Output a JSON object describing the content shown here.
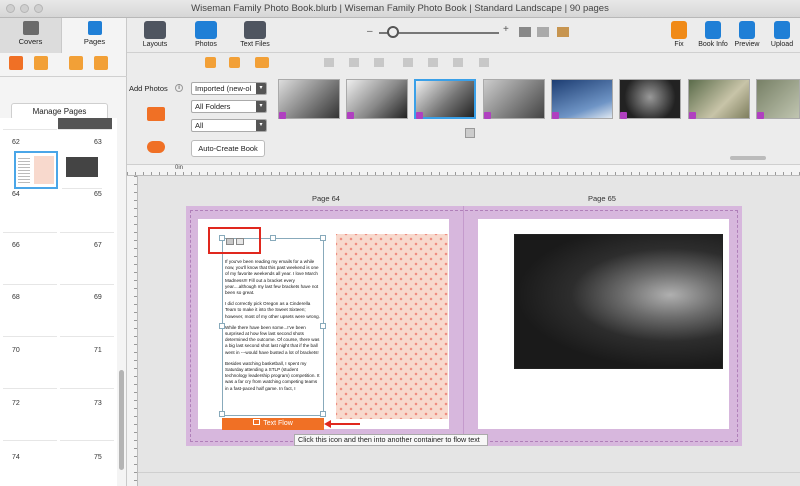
{
  "window": {
    "title": "Wiseman Family Photo Book.blurb | Wiseman Family Photo Book | Standard Landscape | 90 pages"
  },
  "left_panel": {
    "tabs": [
      {
        "label": "Covers"
      },
      {
        "label": "Pages"
      }
    ],
    "manage_pages_label": "Manage Pages",
    "page_numbers": [
      "62",
      "63",
      "64",
      "65",
      "66",
      "67",
      "68",
      "69",
      "70",
      "71",
      "72",
      "73",
      "74",
      "75"
    ]
  },
  "toolbar": {
    "left": [
      {
        "label": "Layouts"
      },
      {
        "label": "Photos"
      },
      {
        "label": "Text Files"
      }
    ],
    "right": [
      {
        "label": "Fix"
      },
      {
        "label": "Book Info"
      },
      {
        "label": "Preview"
      },
      {
        "label": "Upload"
      }
    ],
    "zoom_minus": "–",
    "zoom_plus": "+"
  },
  "photos": {
    "add_photos_label": "Add Photos",
    "info": "i",
    "source_select": "Imported (new-ol",
    "folder_select": "All Folders",
    "filter_select": "All",
    "auto_create_label": "Auto-Create Book"
  },
  "ruler": {
    "label": "0in"
  },
  "spread": {
    "left_page_label": "Page 64",
    "right_page_label": "Page 65",
    "text_paragraphs": [
      "If you've been reading my emails for a while now, you'll know that this past weekend is one of my favorite weekends all year. I love March Madness!!! Fill out a bracket every year....although my last few brackets have not been so great.",
      "I did correctly pick Oregon as a Cinderella Team to make it into the Sweet Sixteen; however, most of my other upsets were wrong.",
      "While there have been some...I've been surprised at how few last second shots determined the outcome. Of course, there was a big last second shot last night that if the ball went in ---would have busted a lot of brackets!",
      "Besides watching basketball, I spent my Saturday attending a STLP (student technology leadership program) competition. It was a far cry from watching competing teams in a fast-paced half game. In fact, I"
    ],
    "text_flow_label": "Text Flow",
    "tooltip": "Click this icon and then into another container to flow text"
  },
  "colors": {
    "accent_orange": "#f07025",
    "highlight_red": "#e0281e",
    "spread_purple": "#d7b7dd",
    "polka_bg": "#f8d9cd",
    "polka_dot": "#ef8f82"
  }
}
